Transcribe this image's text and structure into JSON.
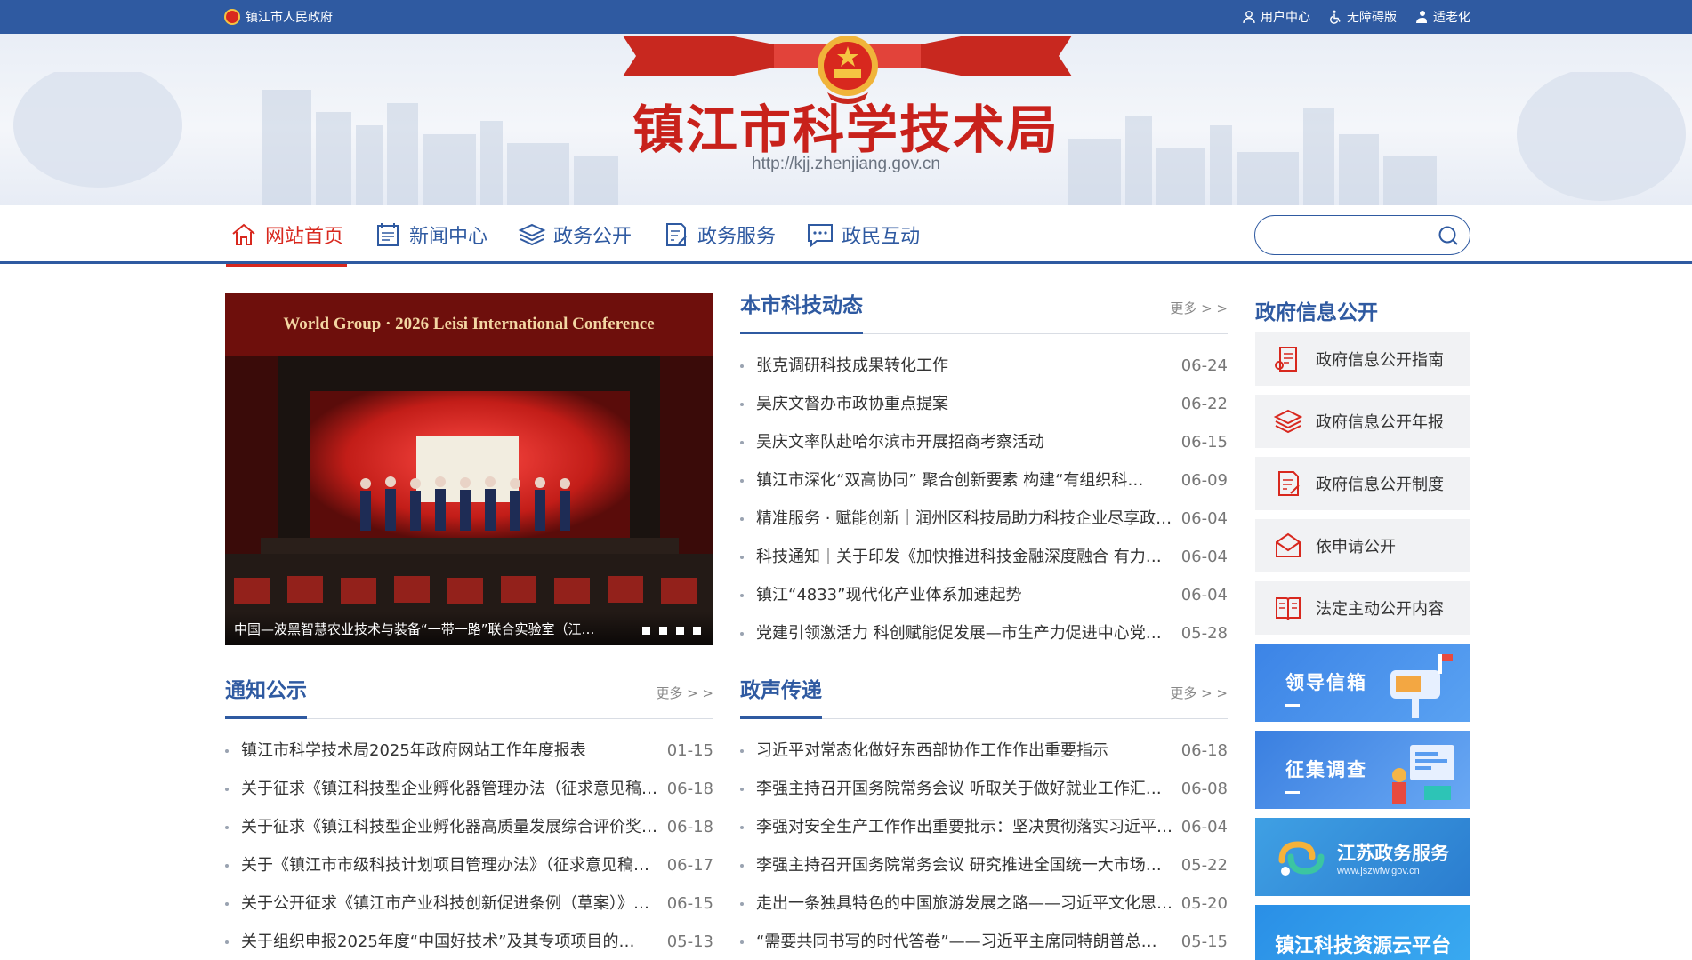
{
  "topbar": {
    "site_link": "镇江市人民政府",
    "user_center": "用户中心",
    "accessibility": "无障碍版",
    "elderly": "适老化"
  },
  "header": {
    "title": "镇江市科学技术局",
    "url": "http://kjj.zhenjiang.gov.cn"
  },
  "nav": {
    "items": [
      {
        "label": "网站首页",
        "icon": "home-icon"
      },
      {
        "label": "新闻中心",
        "icon": "news-icon"
      },
      {
        "label": "政务公开",
        "icon": "layers-icon"
      },
      {
        "label": "政务服务",
        "icon": "service-icon"
      },
      {
        "label": "政民互动",
        "icon": "chat-icon"
      }
    ],
    "search_placeholder": ""
  },
  "slider": {
    "banner_text": "World Group · 2026 Leisi International Conference",
    "caption": "中国—波黑智慧农业技术与装备“一带一路”联合实验室（江…",
    "dots": 4
  },
  "sections": {
    "local_news": {
      "title": "本市科技动态",
      "more": "更多 > >",
      "items": [
        {
          "title": "张克调研科技成果转化工作",
          "date": "06-24"
        },
        {
          "title": "吴庆文督办市政协重点提案",
          "date": "06-22"
        },
        {
          "title": "吴庆文率队赴哈尔滨市开展招商考察活动",
          "date": "06-15"
        },
        {
          "title": "镇江市深化“双高协同” 聚合创新要素 构建“有组织科…",
          "date": "06-09"
        },
        {
          "title": "精准服务 · 赋能创新｜润州区科技局助力科技企业尽享政…",
          "date": "06-04"
        },
        {
          "title": "科技通知｜关于印发《加快推进科技金融深度融合 有力支…",
          "date": "06-04"
        },
        {
          "title": "镇江“4833”现代化产业体系加速起势",
          "date": "06-04"
        },
        {
          "title": "党建引领激活力 科创赋能促发展—市生产力促进中心党…",
          "date": "05-28"
        }
      ]
    },
    "notices": {
      "title": "通知公示",
      "more": "更多 > >",
      "items": [
        {
          "title": "镇江市科学技术局2025年政府网站工作年度报表",
          "date": "01-15"
        },
        {
          "title": "关于征求《镇江科技型企业孵化器管理办法（征求意见稿…",
          "date": "06-18"
        },
        {
          "title": "关于征求《镇江科技型企业孵化器高质量发展综合评价奖…",
          "date": "06-18"
        },
        {
          "title": "关于《镇江市市级科技计划项目管理办法》（征求意见稿…",
          "date": "06-17"
        },
        {
          "title": "关于公开征求《镇江市产业科技创新促进条例（草案）》…",
          "date": "06-15"
        },
        {
          "title": "关于组织申报2025年度“中国好技术”及其专项项目的…",
          "date": "05-13"
        }
      ]
    },
    "policy_voice": {
      "title": "政声传递",
      "more": "更多 > >",
      "items": [
        {
          "title": "习近平对常态化做好东西部协作工作作出重要指示",
          "date": "06-18"
        },
        {
          "title": "李强主持召开国务院常务会议 听取关于做好就业工作汇…",
          "date": "06-08"
        },
        {
          "title": "李强对安全生产工作作出重要批示：坚决贯彻落实习近平…",
          "date": "06-04"
        },
        {
          "title": "李强主持召开国务院常务会议 研究推进全国统一大市场…",
          "date": "05-22"
        },
        {
          "title": "走出一条独具特色的中国旅游发展之路——习近平文化思…",
          "date": "05-20"
        },
        {
          "title": "“需要共同书写的时代答卷”——习近平主席同特朗普总…",
          "date": "05-15"
        }
      ]
    }
  },
  "gov_info": {
    "title": "政府信息公开",
    "items": [
      {
        "label": "政府信息公开指南",
        "icon": "guide-icon"
      },
      {
        "label": "政府信息公开年报",
        "icon": "layers-icon"
      },
      {
        "label": "政府信息公开制度",
        "icon": "document-icon"
      },
      {
        "label": "依申请公开",
        "icon": "envelope-icon"
      },
      {
        "label": "法定主动公开内容",
        "icon": "book-icon"
      }
    ]
  },
  "promos": {
    "mailbox": "领导信箱",
    "survey": "征集调查",
    "js_service_name": "江苏政务服务",
    "js_service_sub": "www.jszwfw.gov.cn",
    "cloud": "镇江科技资源云平台"
  },
  "colors": {
    "primary": "#2f5aa1",
    "accent_red": "#d8281e",
    "title_red": "#c8211b"
  }
}
